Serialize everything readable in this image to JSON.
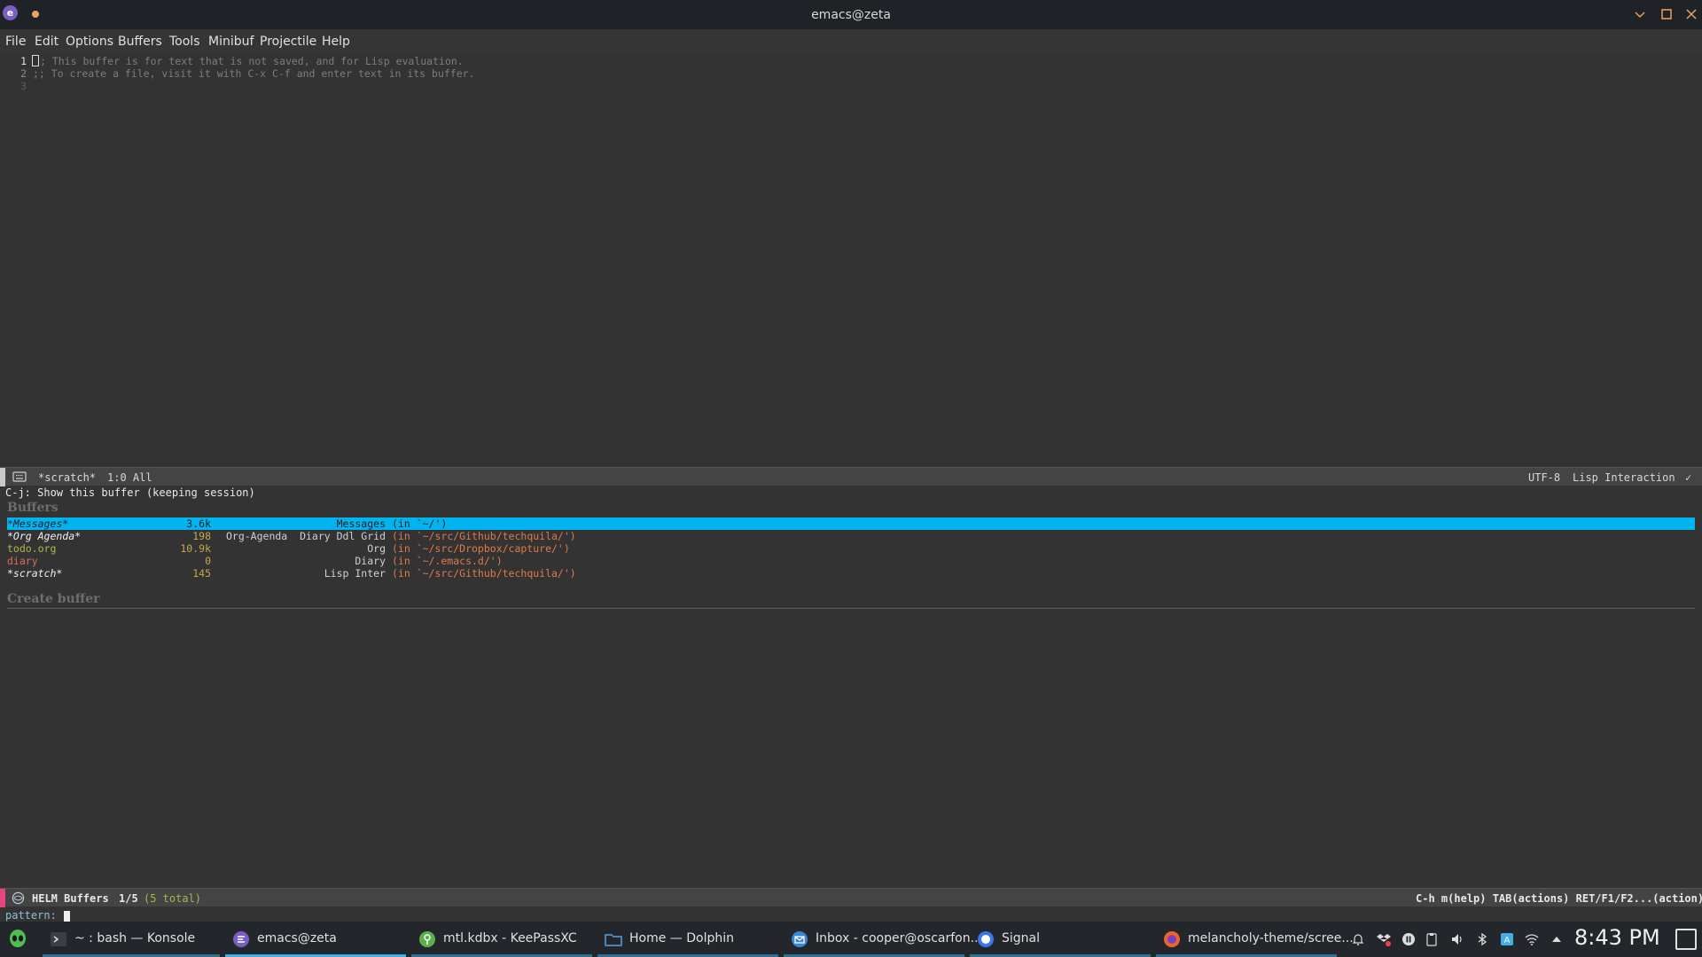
{
  "window": {
    "title": "emacs@zeta"
  },
  "menu": [
    "File",
    "Edit",
    "Options",
    "Buffers",
    "Tools",
    "Minibuf",
    "Projectile",
    "Help"
  ],
  "editor": {
    "lines": [
      {
        "num": "1",
        "text": "; This buffer is for text that is not saved, and for Lisp evaluation."
      },
      {
        "num": "2",
        "text": ";; To create a file, visit it with C-x C-f and enter text in its buffer."
      },
      {
        "num": "3",
        "text": ""
      }
    ]
  },
  "modeline": {
    "buffer": "*scratch*",
    "position": "1:0 All",
    "encoding": "UTF-8",
    "mode": "Lisp Interaction",
    "check": "✓"
  },
  "helm": {
    "header": "C-j: Show this buffer (keeping session)",
    "sources": {
      "buffers": "Buffers",
      "create": "Create buffer"
    },
    "rows": [
      {
        "name": "*Messages*",
        "size": "3.6k",
        "mode": "Messages",
        "path": "(in `~/')"
      },
      {
        "name": "*Org Agenda*",
        "size": "198",
        "mode": "Org-Agenda  Diary Ddl Grid",
        "path": "(in `~/src/Github/techquila/')"
      },
      {
        "name": "todo.org",
        "size": "10.9k",
        "mode": "Org",
        "path": "(in `~/src/Dropbox/capture/')"
      },
      {
        "name": "diary",
        "size": "0",
        "mode": "Diary",
        "path": "(in `~/.emacs.d/')"
      },
      {
        "name": "*scratch*",
        "size": "145",
        "mode": "Lisp Inter",
        "path": "(in `~/src/Github/techquila/')"
      }
    ],
    "modeline": {
      "name": "HELM Buffers",
      "count": "1/5",
      "total": "(5 total)",
      "keys": "C-h m(help) TAB(actions) RET/F1/F2...(action)"
    },
    "prompt": "pattern:"
  },
  "taskbar": {
    "tasks": [
      {
        "label": "~ : bash — Konsole",
        "icon": "terminal-icon",
        "color": "#3a3f44"
      },
      {
        "label": "emacs@zeta",
        "icon": "emacs-icon",
        "color": "#7a5fc0"
      },
      {
        "label": "mtl.kdbx - KeePassXC",
        "icon": "keepassxc-icon",
        "color": "#5bb04a"
      },
      {
        "label": "Home — Dolphin",
        "icon": "folder-icon",
        "color": "#2b6aa8"
      },
      {
        "label": "Inbox - cooper@oscarfon...",
        "icon": "mail-icon",
        "color": "#3a86d6"
      },
      {
        "label": "Signal",
        "icon": "signal-icon",
        "color": "#3a76f0"
      },
      {
        "label": "melancholy-theme/scree...",
        "icon": "firefox-icon",
        "color": "#e8662a"
      }
    ],
    "clock": "8:43 PM"
  },
  "colors": {
    "selection": "#00b4f0",
    "helm_edge": "#e44680",
    "path": "#e07a48"
  }
}
